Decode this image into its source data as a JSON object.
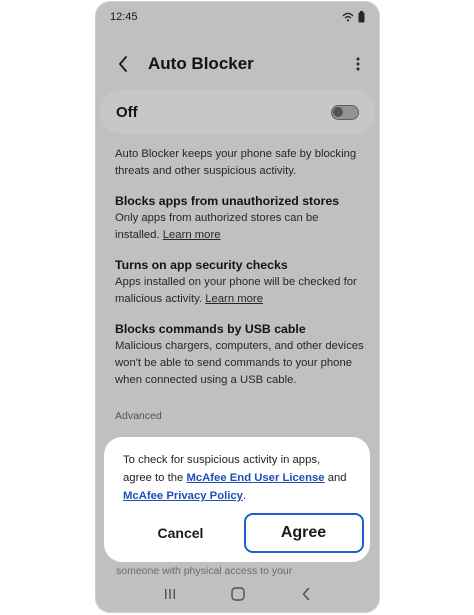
{
  "status": {
    "time": "12:45"
  },
  "header": {
    "title": "Auto Blocker"
  },
  "toggle": {
    "label": "Off",
    "state": "off"
  },
  "content": {
    "intro": "Auto Blocker keeps your phone safe by blocking threats and other suspicious activity.",
    "sections": [
      {
        "title": "Blocks apps from unauthorized stores",
        "text": "Only apps from authorized stores can be installed.",
        "link": "Learn more"
      },
      {
        "title": "Turns on app security checks",
        "text": "Apps installed on your phone will be checked for malicious activity.",
        "link": "Learn more"
      },
      {
        "title": "Blocks commands by USB cable",
        "text": "Malicious chargers, computers, and other devices won't be able to send commands to your phone when connected using a USB cable.",
        "link": ""
      }
    ],
    "advanced_label": "Advanced",
    "faded_text": "someone with physical access to your"
  },
  "dialog": {
    "text_before": "To check for suspicious activity in apps, agree to the ",
    "link1": "McAfee End User License",
    "text_mid": " and ",
    "link2": "McAfee Privacy Policy",
    "text_after": ".",
    "cancel_label": "Cancel",
    "agree_label": "Agree"
  },
  "colors": {
    "link_blue": "#1f4fb6",
    "agree_border": "#1f5fcf",
    "overlay": "rgba(0,0,0,0.22)"
  },
  "icons": {
    "back": "chevron-left-icon",
    "more": "more-vertical-icon",
    "wifi": "wifi-icon",
    "battery": "battery-icon",
    "recents": "recents-icon",
    "home": "home-icon",
    "nav_back": "nav-back-icon"
  }
}
